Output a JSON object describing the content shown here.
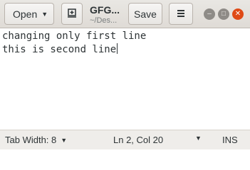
{
  "header": {
    "open_label": "Open",
    "title": "GFG...",
    "subtitle": "~/Des...",
    "save_label": "Save",
    "menu_icon": "hamburger-menu-icon",
    "pin_icon": "new-document-icon"
  },
  "window_controls": {
    "minimize_glyph": "–",
    "maximize_glyph": "□",
    "close_glyph": "✕",
    "close_color": "#df4a16"
  },
  "editor": {
    "lines": [
      "changing only first line",
      "this is second line"
    ]
  },
  "status_bar": {
    "tab_width": "Tab Width: 8",
    "cursor_position": "Ln 2, Col 20",
    "insert_mode": "INS"
  },
  "colors": {
    "header_bg": "#e3e0dc",
    "editor_bg": "#ffffff",
    "text": "#2e3436"
  }
}
